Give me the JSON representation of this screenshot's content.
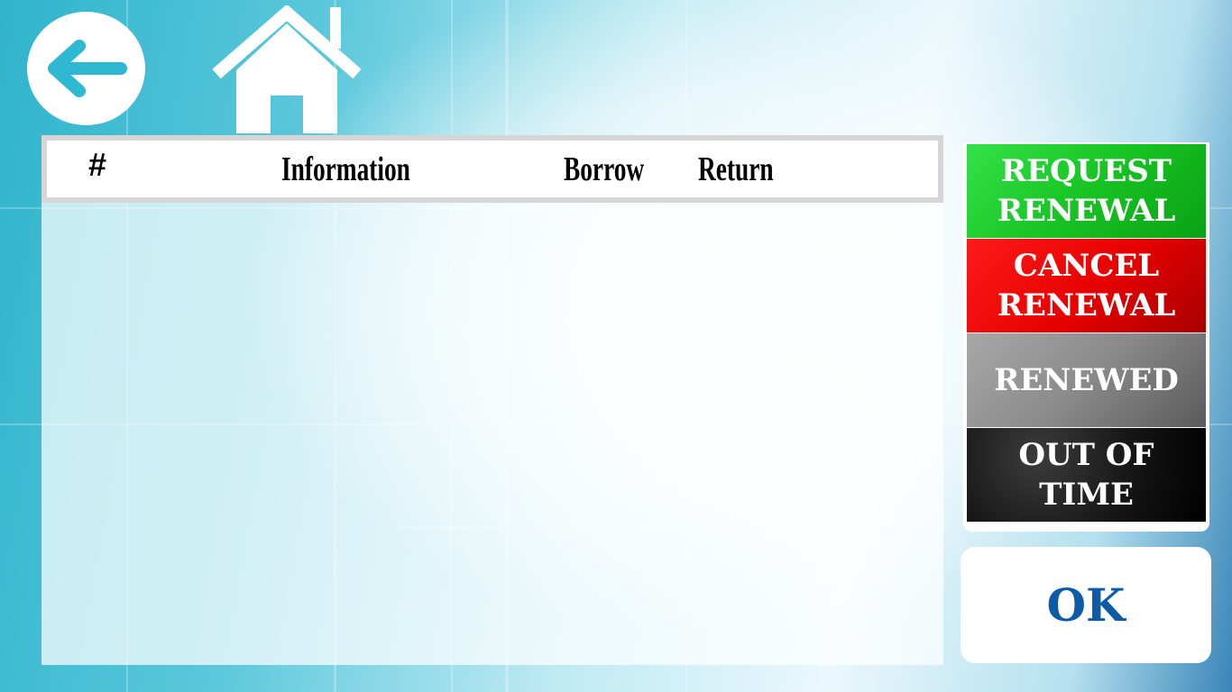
{
  "header": {
    "back_icon": "arrow-left-icon",
    "home_icon": "home-icon"
  },
  "table": {
    "columns": [
      "#",
      "Information",
      "Borrow",
      "Return"
    ],
    "rows": []
  },
  "legend": {
    "items": [
      {
        "line1": "REQUEST",
        "line2": "RENEWAL",
        "color": "#17c423"
      },
      {
        "line1": "CANCEL",
        "line2": "RENEWAL",
        "color": "#e60000"
      },
      {
        "line1": "RENEWED",
        "line2": "",
        "color": "#8a8a8a"
      },
      {
        "line1": "OUT OF",
        "line2": "TIME",
        "color": "#000000"
      }
    ]
  },
  "ok_button": {
    "label": "OK",
    "color": "#0d5aa7"
  },
  "colors": {
    "accent": "#2fb4cc",
    "header_border": "#d6d6d6"
  }
}
